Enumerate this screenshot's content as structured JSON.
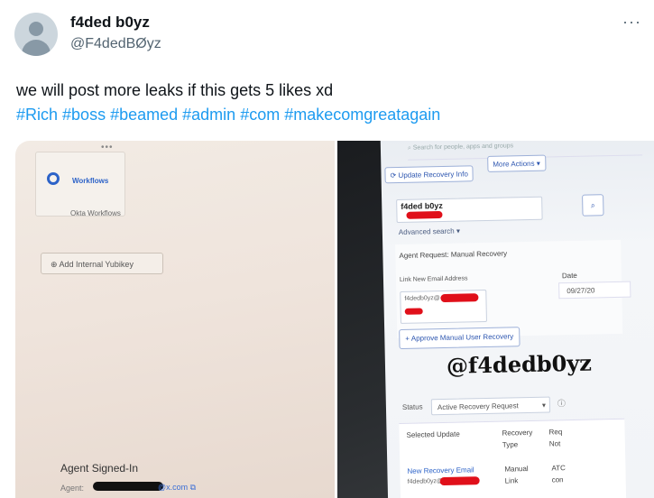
{
  "post": {
    "display_name": "f4ded b0yz",
    "handle": "@F4dedBØyz",
    "more_glyph": "···",
    "text": "we will post more leaks if this gets 5 likes xd",
    "hashtags": [
      "#Rich",
      "#boss",
      "#beamed",
      "#admin",
      "#com",
      "#makecomgreatagain"
    ]
  },
  "photo_left": {
    "dots": "•••",
    "workflows_title": "Workflows",
    "workflows_sub": "Okta Workflows",
    "yubikey_button": "Add Internal Yubikey",
    "signed_in_label": "Agent Signed-In",
    "agent_label": "Agent:",
    "agent_email_tail": "@x.com"
  },
  "photo_right": {
    "search_placeholder": "Search for people, apps and groups",
    "update_recovery_button": "Update Recovery Info",
    "more_actions_button": "More Actions",
    "user_name": "f4ded b0yz",
    "advanced_search": "Advanced search ▾",
    "agent_request": "Agent Request: Manual Recovery",
    "link_email_label": "Link New Email Address",
    "email_prefix": "f4dedb0yz@",
    "date_label": "Date",
    "date_value": "09/27/20",
    "approve_button": "Approve Manual User Recovery",
    "watermark": "@f4dedb0yz",
    "status_label": "Status",
    "status_value": "Active Recovery Request",
    "table_headers": [
      "Selected Update",
      "Recovery Type",
      "Req Not"
    ],
    "table_row": [
      "New Recovery Email",
      "Manual Link",
      "ATC con"
    ],
    "row_email_prefix": "f4dedb0yz@"
  },
  "colors": {
    "link": "#1d9bf0",
    "redaction": "#e0101a"
  }
}
